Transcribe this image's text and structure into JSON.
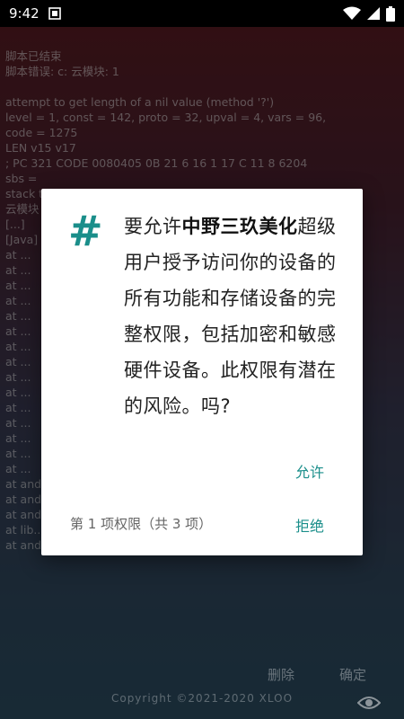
{
  "status_bar": {
    "time": "9:42",
    "notification_icon": "photo-notification-icon",
    "wifi_icon": "wifi-icon",
    "signal_icon": "cell-signal-icon",
    "battery_icon": "battery-icon"
  },
  "console": {
    "lines": [
      "脚本已结束",
      "脚本错误: c: 云模块: 1",
      "",
      "attempt to get length of a nil value (method '?')",
      "level = 1, const = 142, proto = 32, upval = 4, vars = 96,",
      "code = 1275",
      "LEN v15 v17",
      " ; PC 321 CODE 0080405 0B 21 6 16 1 17 C 11 8 6204",
      "sbs =",
      "stack traceback:",
      "  云模块",
      "  [...]",
      "  [Java]",
      "  at ...",
      "  at ...",
      "  at ...",
      "  at ...",
      "  at ...",
      "  at ...",
      "  at ...",
      "  at ...",
      "  at ...",
      "  at ...",
      "  at ...",
      "  at ...",
      "  at ...",
      "  at ...",
      "  at ...",
      "  at android.ext...",
      "  at android.ext.(Unknown Source:8)",
      "  at android.ext_(Unknown Source:8)",
      "  at lib... (Unknown Source:6)",
      "  at android.ext_run(Unknown Source:43)"
    ]
  },
  "background_actions": {
    "delete_label": "删除",
    "ok_label": "确定"
  },
  "copyright": "Copyright ©2021-2020 XLOO",
  "dialog": {
    "icon_symbol": "#",
    "message_prefix": "要允许",
    "app_name": "中野三玖美化",
    "message_suffix": "超级用户授予访问你的设备的所有功能和存储设备的完整权限，包括加密和敏感硬件设备。此权限有潜在的风险。吗?",
    "allow_label": "允许",
    "page_info": "第 1 项权限（共 3 项）",
    "deny_label": "拒绝"
  },
  "colors": {
    "accent": "#1a8e8a",
    "statusbar": "#000000",
    "dialog_bg": "#ffffff"
  }
}
